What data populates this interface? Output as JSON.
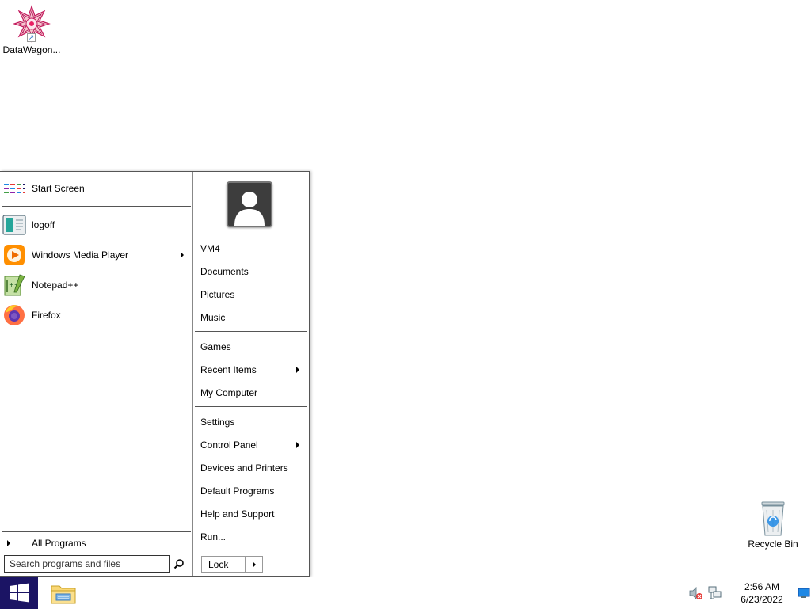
{
  "desktop": {
    "icons": [
      {
        "label": "DataWagon...",
        "icon": "datawagon-icon"
      },
      {
        "label": "Recycle Bin",
        "icon": "recycle-bin-icon"
      }
    ]
  },
  "start_menu": {
    "left": {
      "start_screen": "Start Screen",
      "pinned": [
        {
          "label": "logoff",
          "icon": "logoff-icon"
        },
        {
          "label": "Windows Media Player",
          "icon": "media-player-icon",
          "has_submenu": true
        },
        {
          "label": "Notepad++",
          "icon": "notepad-plus-plus-icon"
        },
        {
          "label": "Firefox",
          "icon": "firefox-icon"
        }
      ],
      "all_programs": "All Programs",
      "search_placeholder": "Search programs and files"
    },
    "right": {
      "items": [
        {
          "label": "VM4"
        },
        {
          "label": "Documents"
        },
        {
          "label": "Pictures"
        },
        {
          "label": "Music"
        },
        {
          "label": "Games"
        },
        {
          "label": "Recent Items",
          "has_submenu": true
        },
        {
          "label": "My Computer"
        },
        {
          "label": "Settings"
        },
        {
          "label": "Control Panel",
          "has_submenu": true
        },
        {
          "label": "Devices and Printers"
        },
        {
          "label": "Default Programs"
        },
        {
          "label": "Help and Support"
        },
        {
          "label": "Run..."
        }
      ],
      "power_button": "Lock"
    }
  },
  "taskbar": {
    "clock_time": "2:56 AM",
    "clock_date": "6/23/2022"
  },
  "colors": {
    "start_button": "#1b1464",
    "accent": "#1565c0"
  }
}
